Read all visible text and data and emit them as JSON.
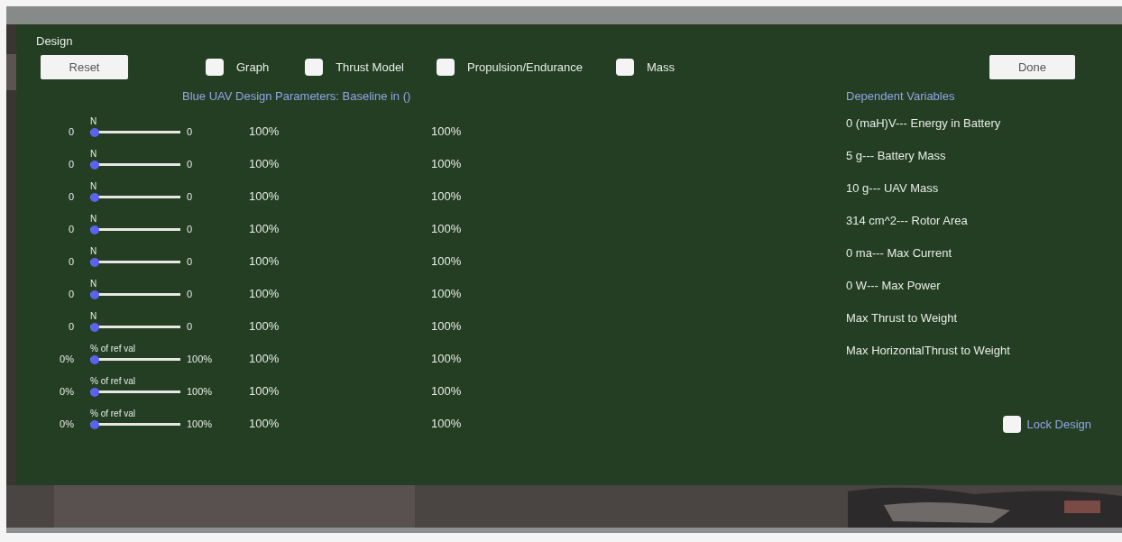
{
  "window": {
    "title": "Design"
  },
  "reset_button": "Reset",
  "toggles": [
    {
      "label": "Graph",
      "checked": false
    },
    {
      "label": "Thrust Model",
      "checked": false
    },
    {
      "label": "Propulsion/Endurance",
      "checked": false
    },
    {
      "label": "Mass",
      "checked": false
    }
  ],
  "done_button": "Done",
  "parameters": {
    "title": "Blue UAV Design Parameters: Baseline in ()",
    "rows": [
      {
        "unit": "N",
        "min": "0",
        "max": "0",
        "level": 0,
        "value_1": "100%",
        "value_2": "100%"
      },
      {
        "unit": "N",
        "min": "0",
        "max": "0",
        "level": 0,
        "value_1": "100%",
        "value_2": "100%"
      },
      {
        "unit": "N",
        "min": "0",
        "max": "0",
        "level": 0,
        "value_1": "100%",
        "value_2": "100%"
      },
      {
        "unit": "N",
        "min": "0",
        "max": "0",
        "level": 0,
        "value_1": "100%",
        "value_2": "100%"
      },
      {
        "unit": "N",
        "min": "0",
        "max": "0",
        "level": 0,
        "value_1": "100%",
        "value_2": "100%"
      },
      {
        "unit": "N",
        "min": "0",
        "max": "0",
        "level": 0,
        "value_1": "100%",
        "value_2": "100%"
      },
      {
        "unit": "N",
        "min": "0",
        "max": "0",
        "level": 0,
        "value_1": "100%",
        "value_2": "100%"
      },
      {
        "unit": "% of ref val",
        "min": "0%",
        "max": "100%",
        "level": 0,
        "value_1": "100%",
        "value_2": "100%"
      },
      {
        "unit": "% of ref val",
        "min": "0%",
        "max": "100%",
        "level": 0,
        "value_1": "100%",
        "value_2": "100%"
      },
      {
        "unit": "% of ref val",
        "min": "0%",
        "max": "100%",
        "level": 0,
        "value_1": "100%",
        "value_2": "100%"
      }
    ]
  },
  "dependent": {
    "title": "Dependent Variables",
    "items": [
      "0 (maH)V--- Energy in Battery",
      "5 g--- Battery Mass",
      "10 g--- UAV Mass",
      "314 cm^2--- Rotor Area",
      "0 ma--- Max Current",
      "0 W--- Max Power",
      "Max Thrust to Weight",
      "Max HorizontalThrust to Weight"
    ]
  },
  "lock_design": {
    "label": "Lock Design",
    "checked": false
  }
}
